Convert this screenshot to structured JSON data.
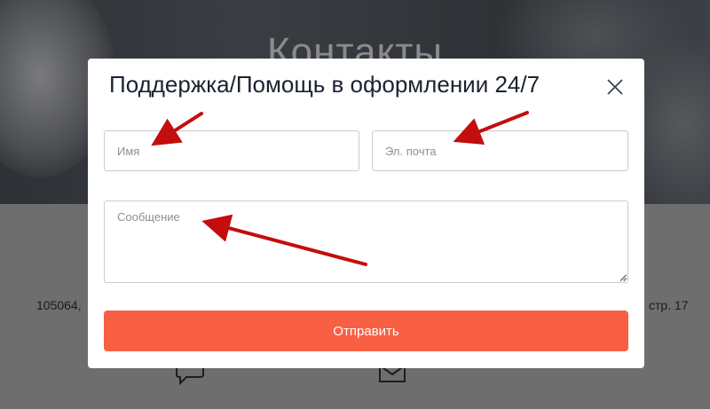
{
  "background": {
    "hero_title": "Контакты",
    "address_left": "105064,",
    "address_right": "стр. 17"
  },
  "modal": {
    "title": "Поддержка/Помощь в оформлении 24/7",
    "name_placeholder": "Имя",
    "email_placeholder": "Эл. почта",
    "message_placeholder": "Сообщение",
    "submit_label": "Отправить"
  },
  "colors": {
    "accent": "#f85f43",
    "annotation_arrow": "#c40d0d",
    "title_text": "#1a2231"
  },
  "icons": [
    "close-icon",
    "chat-icon",
    "mail-icon",
    "resize-handle-icon",
    "arrow-annotation"
  ]
}
